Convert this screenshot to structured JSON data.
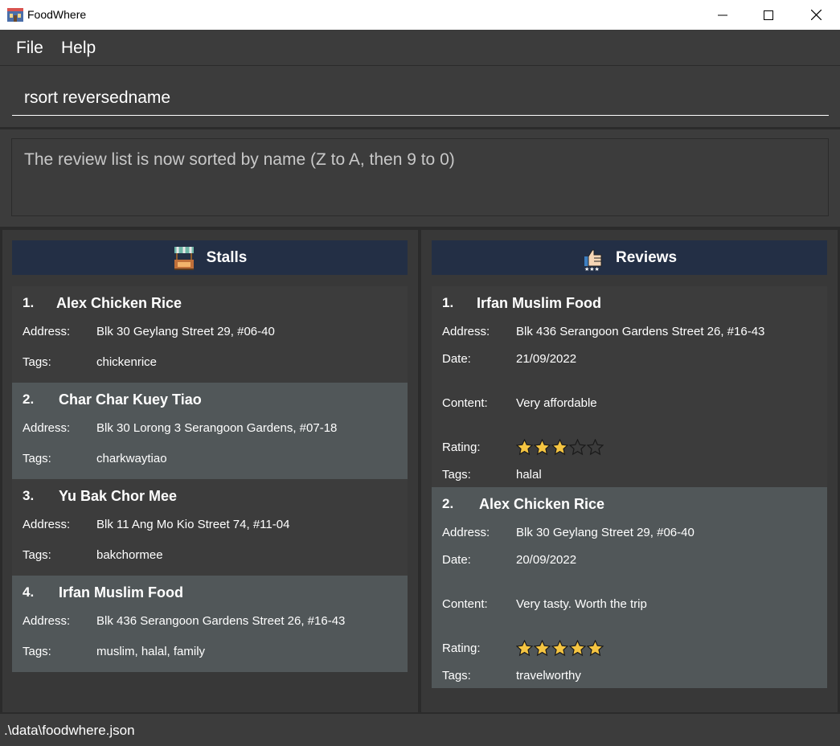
{
  "window": {
    "title": "FoodWhere",
    "controls": {
      "minimize": "—",
      "maximize": "☐",
      "close": "✕"
    }
  },
  "menu": [
    {
      "label": "File"
    },
    {
      "label": "Help"
    }
  ],
  "command": {
    "value": "rsort reversedname",
    "placeholder": ""
  },
  "result": {
    "text": "The review list is now sorted by name (Z to A, then 9 to 0)"
  },
  "stalls": {
    "header": "Stalls",
    "icon": "stall-icon",
    "labels": {
      "address": "Address:",
      "tags": "Tags:"
    },
    "items": [
      {
        "index": "1.",
        "name": "Alex Chicken Rice",
        "address": "Blk 30 Geylang Street 29, #06-40",
        "tags": "chickenrice"
      },
      {
        "index": "2.",
        "name": "Char Char Kuey Tiao",
        "address": "Blk 30 Lorong 3 Serangoon Gardens, #07-18",
        "tags": "charkwaytiao"
      },
      {
        "index": "3.",
        "name": "Yu Bak Chor Mee",
        "address": "Blk 11 Ang Mo Kio Street 74, #11-04",
        "tags": "bakchormee"
      },
      {
        "index": "4.",
        "name": "Irfan Muslim Food",
        "address": "Blk 436 Serangoon Gardens Street 26, #16-43",
        "tags": "muslim, halal, family"
      }
    ]
  },
  "reviews": {
    "header": "Reviews",
    "icon": "thumbs-up-icon",
    "labels": {
      "address": "Address:",
      "date": "Date:",
      "content": "Content:",
      "rating": "Rating:",
      "tags": "Tags:"
    },
    "items": [
      {
        "index": "1.",
        "name": "Irfan Muslim Food",
        "address": "Blk 436 Serangoon Gardens Street 26, #16-43",
        "date": "21/09/2022",
        "content": "Very affordable",
        "rating": 3,
        "rating_max": 5,
        "tags": "halal"
      },
      {
        "index": "2.",
        "name": "Alex Chicken Rice",
        "address": "Blk 30 Geylang Street 29, #06-40",
        "date": "20/09/2022",
        "content": "Very tasty. Worth the trip",
        "rating": 5,
        "rating_max": 5,
        "tags": "travelworthy"
      }
    ]
  },
  "status": {
    "path": ".\\data\\foodwhere.json"
  },
  "colors": {
    "background": "#2b2b2b",
    "panel": "#3c3c3c",
    "header": "#232f45",
    "card_alt": "#515759",
    "star": "#f5c542"
  }
}
